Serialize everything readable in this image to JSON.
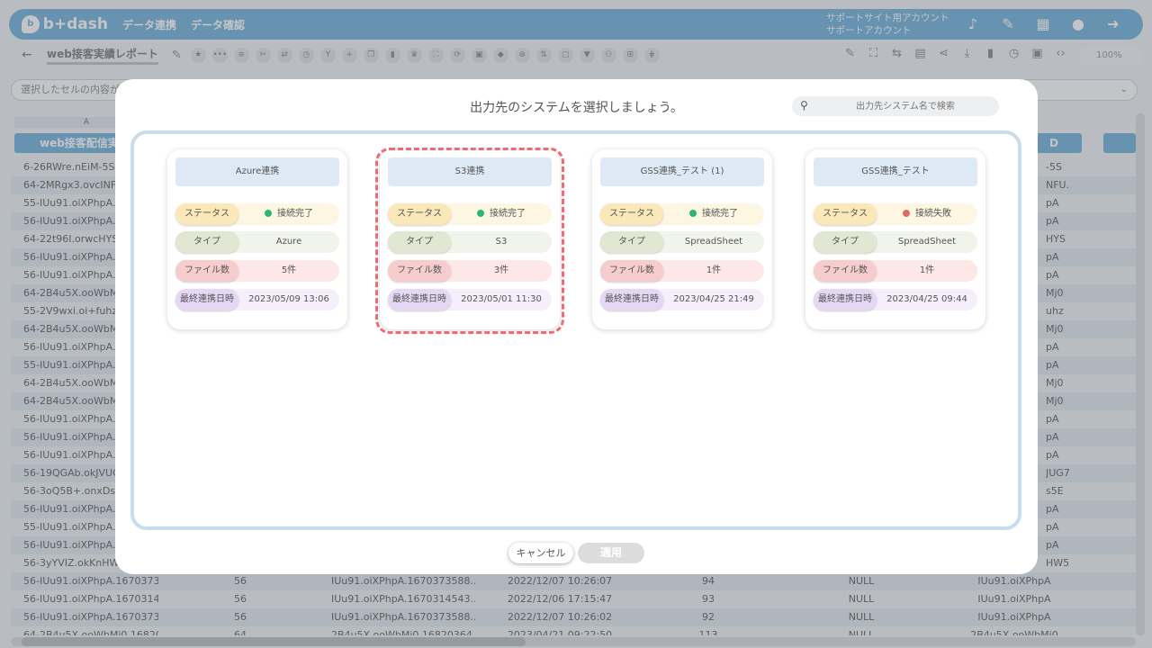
{
  "app": {
    "logo_text": "b+dash",
    "nav": [
      "データ連携",
      "データ確認"
    ],
    "account_line1": "サポートサイト用アカウント",
    "account_line2": "サポートアカウント",
    "top_icons": [
      "bell-icon",
      "wrench-icon",
      "apps-grid-icon",
      "chat-icon",
      "logout-icon"
    ]
  },
  "toolbar": {
    "report_title": "web接客実績レポート",
    "zoom": "100%"
  },
  "cellbar": {
    "placeholder": "選択したセルの内容が表"
  },
  "grid": {
    "col_letter_a": "A",
    "col_head_a": "web接客配信実",
    "col_head_right": "D",
    "rows": [
      {
        "a": "6-26RWre.nEiM-5S.1(",
        "r": "-5S"
      },
      {
        "a": "64-2MRgx3.ovcINFU.",
        "r": "NFU."
      },
      {
        "a": "55-IUu91.oiXPhpA.16",
        "r": "pA"
      },
      {
        "a": "56-IUu91.oiXPhpA.16",
        "r": "pA"
      },
      {
        "a": "64-22t96I.orwcHYS.1",
        "r": "HYS"
      },
      {
        "a": "56-IUu91.oiXPhpA.16",
        "r": "pA"
      },
      {
        "a": "56-IUu91.oiXPhpA.16",
        "r": "pA"
      },
      {
        "a": "64-2B4u5X.ooWbMj0",
        "r": "Mj0"
      },
      {
        "a": "55-2V9wxi.oi+fuhz.1",
        "r": "uhz"
      },
      {
        "a": "64-2B4u5X.ooWbMj0",
        "r": "Mj0"
      },
      {
        "a": "56-IUu91.oiXPhpA.16",
        "r": "pA"
      },
      {
        "a": "55-IUu91.oiXPhpA.16",
        "r": "pA"
      },
      {
        "a": "64-2B4u5X.ooWbMj0",
        "r": "Mj0"
      },
      {
        "a": "64-2B4u5X.ooWbMj0",
        "r": "Mj0"
      },
      {
        "a": "56-IUu91.oiXPhpA.16",
        "r": "pA"
      },
      {
        "a": "56-IUu91.oiXPhpA.16",
        "r": "pA"
      },
      {
        "a": "56-IUu91.oiXPhpA.16",
        "r": "pA"
      },
      {
        "a": "56-19QGAb.okJVUG7",
        "r": "JUG7"
      },
      {
        "a": "56-3oQ5B+.onxDs5E.",
        "r": "s5E"
      },
      {
        "a": "56-IUu91.oiXPhpA.16",
        "r": "pA"
      },
      {
        "a": "55-IUu91.oiXPhpA.16",
        "r": "pA"
      },
      {
        "a": "56-IUu91.oiXPhpA.16",
        "r": "pA"
      },
      {
        "a": "56-3yYVIZ.okKnHW5.",
        "r": "HW5"
      }
    ],
    "bottom_rows": [
      {
        "a": "56-IUu91.oiXPhpA.16703735...",
        "b": "56",
        "c": "IUu91.oiXPhpA.1670373588...",
        "d": "2022/12/07 10:26:07",
        "e": "94",
        "f": "NULL",
        "g": "IUu91.oiXPhpA"
      },
      {
        "a": "56-IUu91.oiXPhpA.16703145...",
        "b": "56",
        "c": "IUu91.oiXPhpA.1670314543...",
        "d": "2022/12/06 17:15:47",
        "e": "93",
        "f": "NULL",
        "g": "IUu91.oiXPhpA"
      },
      {
        "a": "56-IUu91.oiXPhpA.16703735...",
        "b": "56",
        "c": "IUu91.oiXPhpA.1670373588...",
        "d": "2022/12/07 10:26:02",
        "e": "92",
        "f": "NULL",
        "g": "IUu91.oiXPhpA"
      },
      {
        "a": "64-2B4u5X.ooWbMi0.16820...",
        "b": "64",
        "c": "2B4u5X.ooWbMi0.16820364...",
        "d": "2023/04/21 09:22:50",
        "e": "113",
        "f": "NULL",
        "g": "2B4u5X.ooWbMj0"
      }
    ]
  },
  "modal": {
    "title": "出力先のシステムを選択しましょう。",
    "search_placeholder": "出力先システム名で検索",
    "labels": {
      "status": "ステータス",
      "type": "タイプ",
      "files": "ファイル数",
      "last": "最終連携日時"
    },
    "cards": [
      {
        "name": "Azure連携",
        "status": "接続完了",
        "status_ok": true,
        "type": "Azure",
        "files": "5件",
        "last": "2023/05/09 13:06",
        "selected": false
      },
      {
        "name": "S3連携",
        "status": "接続完了",
        "status_ok": true,
        "type": "S3",
        "files": "3件",
        "last": "2023/05/01 11:30",
        "selected": true
      },
      {
        "name": "GSS連携_テスト (1)",
        "status": "接続完了",
        "status_ok": true,
        "type": "SpreadSheet",
        "files": "1件",
        "last": "2023/04/25 21:49",
        "selected": false
      },
      {
        "name": "GSS連携_テスト",
        "status": "接続失敗",
        "status_ok": false,
        "type": "SpreadSheet",
        "files": "1件",
        "last": "2023/04/25 09:44",
        "selected": false
      }
    ],
    "cancel_label": "キャンセル",
    "apply_label": "適用"
  },
  "colors": {
    "accent": "#5aa7d8",
    "selected_outline": "#ee6b75",
    "status_ok": "#2bb673",
    "status_ng": "#e06a6a"
  }
}
